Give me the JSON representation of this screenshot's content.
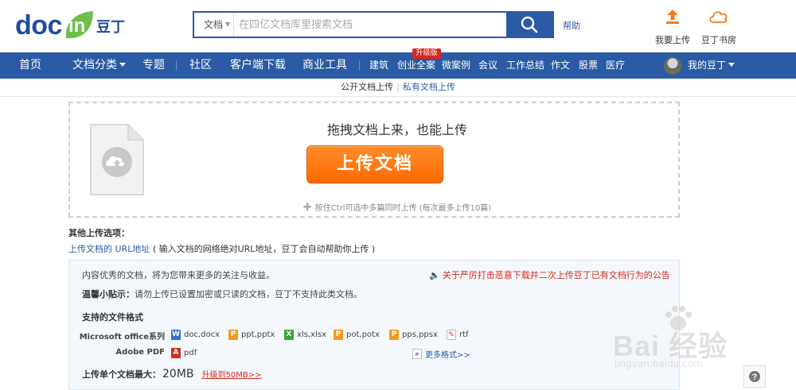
{
  "header": {
    "logo": {
      "doc": "doc",
      "in": "in",
      "cn": "豆丁"
    },
    "search": {
      "type_label": "文档",
      "placeholder": "在四亿文档库里搜索文档"
    },
    "help": "帮助",
    "upload_label": "我要上传",
    "bookstore_label": "豆丁书房"
  },
  "nav": {
    "home": "首页",
    "category": "文档分类",
    "topic": "专题",
    "community": "社区",
    "client": "客户端下载",
    "business": "商业工具",
    "small_links": [
      "建筑",
      "创业全案",
      "微案例",
      "会议",
      "工作总结",
      "作文",
      "股票",
      "医疗"
    ],
    "badge": "升级版",
    "user": "我的豆丁"
  },
  "subtabs": {
    "public": "公开文档上传",
    "separator": "|",
    "private": "私有文档上传"
  },
  "upload": {
    "drag_title": "拖拽文档上来，也能上传",
    "button": "上传文档",
    "tip": "按住Ctrl可选中多篇同时上传 (每次最多上传10篇)"
  },
  "other": {
    "title": "其他上传选项：",
    "url_link": "上传文档的 URL地址",
    "url_desc": "( 输入文档的网络绝对URL地址，豆丁会自动帮助你上传 )"
  },
  "info": {
    "line1": "内容优秀的文档，将为您带来更多的关注与收益。",
    "notice": "关于严厉打击恶意下载并二次上传豆丁已有文档行为的公告",
    "tip_label": "温馨小贴示：",
    "tip_text": "请勿上传已设置加密或只读的文档，豆丁不支持此类文档。",
    "formats_title": "支持的文件格式",
    "office_label": "Microsoft office系列",
    "office_formats": [
      "doc,docx",
      "ppt,pptx",
      "xls,xlsx",
      "pot,potx",
      "pps,ppsx",
      "rtf"
    ],
    "pdf_label": "Adobe PDF",
    "pdf_format": "pdf",
    "more": "更多格式>>",
    "max_label": "上传单个文档最大：",
    "max_size": "20MB",
    "upgrade": "升级到50MB>>"
  },
  "watermark": {
    "text": "Bai 经验",
    "sub": "jingyan.baidu.com"
  },
  "colors": {
    "brand_blue": "#2a5ba4",
    "orange": "#ff6a00",
    "red": "#d8281c",
    "green": "#6cc04a"
  }
}
